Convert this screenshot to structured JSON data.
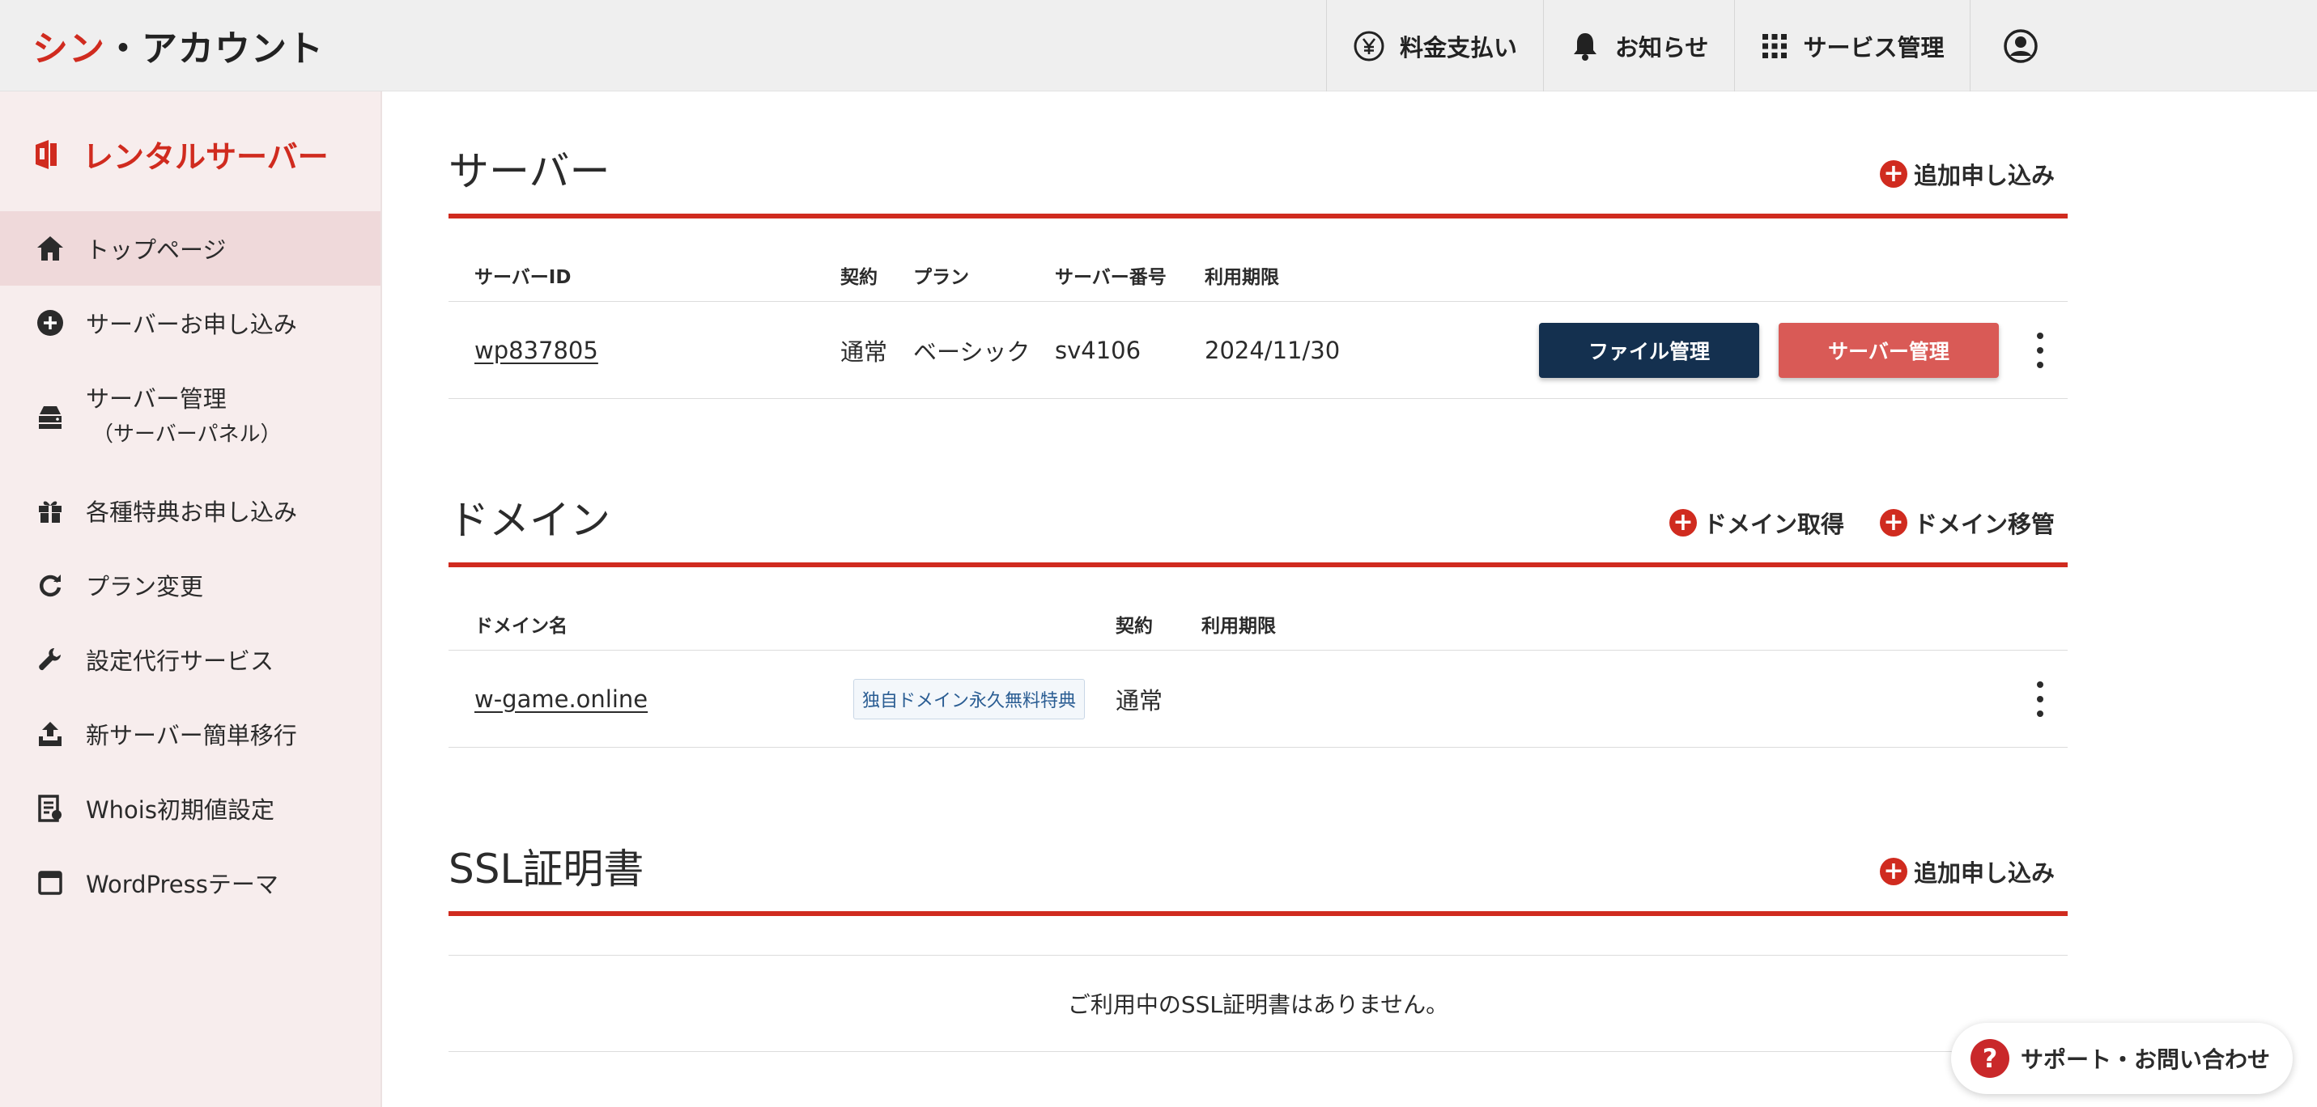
{
  "header": {
    "logo_red": "シン",
    "logo_dark": "・アカウント",
    "nav": {
      "billing": "料金支払い",
      "notices": "お知らせ",
      "services": "サービス管理"
    }
  },
  "sidebar": {
    "title": "レンタルサーバー",
    "items": [
      {
        "label": "トップページ",
        "icon": "home-icon"
      },
      {
        "label": "サーバーお申し込み",
        "icon": "plus-circle-icon"
      },
      {
        "label": "サーバー管理",
        "sub": "（サーバーパネル）",
        "icon": "server-icon"
      },
      {
        "label": "各種特典お申し込み",
        "icon": "gift-icon"
      },
      {
        "label": "プラン変更",
        "icon": "refresh-icon"
      },
      {
        "label": "設定代行サービス",
        "icon": "wrench-icon"
      },
      {
        "label": "新サーバー簡単移行",
        "icon": "upload-icon"
      },
      {
        "label": "Whois初期値設定",
        "icon": "document-icon"
      },
      {
        "label": "WordPressテーマ",
        "icon": "window-icon"
      }
    ]
  },
  "server_section": {
    "title": "サーバー",
    "add_action": "追加申し込み",
    "columns": {
      "id": "サーバーID",
      "contract": "契約",
      "plan": "プラン",
      "number": "サーバー番号",
      "expiry": "利用期限"
    },
    "row": {
      "id": "wp837805",
      "contract": "通常",
      "plan": "ベーシック",
      "number": "sv4106",
      "expiry": "2024/11/30"
    },
    "file_button": "ファイル管理",
    "manage_button": "サーバー管理"
  },
  "domain_section": {
    "title": "ドメイン",
    "acquire_action": "ドメイン取得",
    "transfer_action": "ドメイン移管",
    "columns": {
      "name": "ドメイン名",
      "contract": "契約",
      "expiry": "利用期限"
    },
    "row": {
      "name": "w-game.online",
      "badge": "独自ドメイン永久無料特典",
      "contract": "通常"
    }
  },
  "ssl_section": {
    "title": "SSL証明書",
    "add_action": "追加申し込み",
    "empty_message": "ご利用中のSSL証明書はありません。"
  },
  "support": {
    "label": "サポート・お問い合わせ",
    "icon_glyph": "?"
  },
  "colors": {
    "accent": "#d02b1f",
    "navy": "#14304f",
    "button_red": "#d95a56",
    "sidebar_bg": "#f7eded",
    "sidebar_active": "#efd9da"
  }
}
